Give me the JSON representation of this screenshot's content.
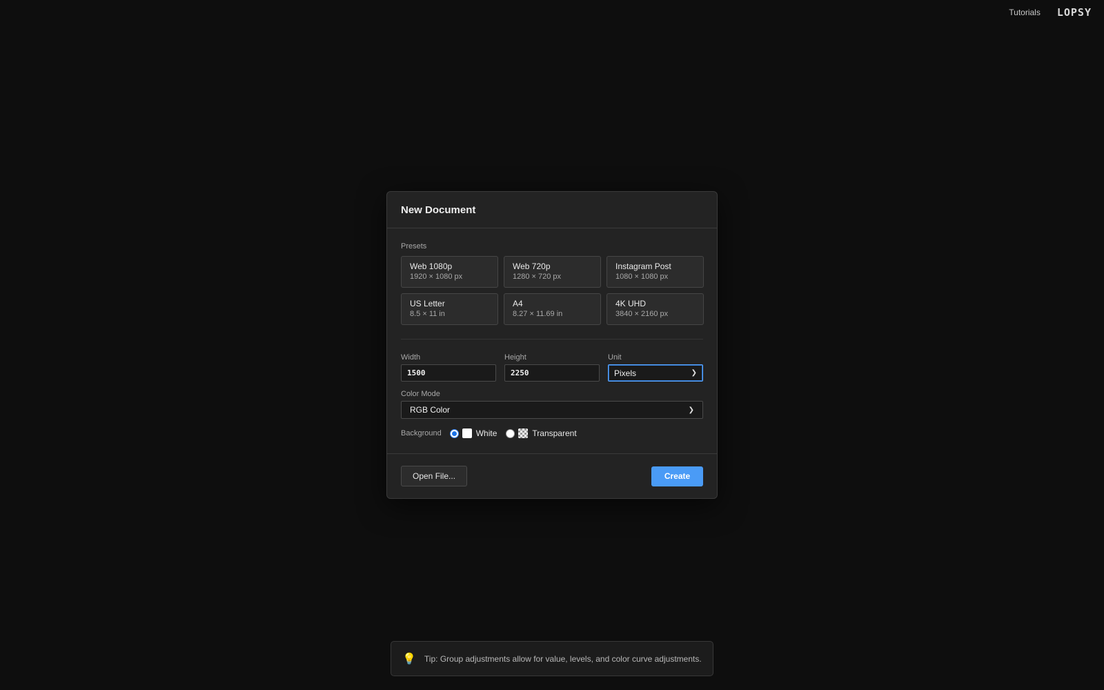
{
  "topbar": {
    "tutorials_label": "Tutorials",
    "logo_text": "LOPSY"
  },
  "dialog": {
    "title": "New Document",
    "presets_label": "Presets",
    "presets": [
      {
        "name": "Web 1080p",
        "size": "1920 × 1080 px"
      },
      {
        "name": "Web 720p",
        "size": "1280 × 720 px"
      },
      {
        "name": "Instagram Post",
        "size": "1080 × 1080 px"
      },
      {
        "name": "US Letter",
        "size": "8.5 × 11 in"
      },
      {
        "name": "A4",
        "size": "8.27 × 11.69 in"
      },
      {
        "name": "4K UHD",
        "size": "3840 × 2160 px"
      }
    ],
    "width": {
      "label": "Width",
      "value": "1500"
    },
    "height": {
      "label": "Height",
      "value": "2250"
    },
    "unit": {
      "label": "Unit",
      "selected": "Pixels"
    },
    "color_mode": {
      "label": "Color Mode",
      "selected": "RGB Color"
    },
    "background": {
      "label": "Background",
      "options": [
        {
          "label": "White",
          "checked": true
        },
        {
          "label": "Transparent",
          "checked": false
        }
      ]
    },
    "open_file_label": "Open File...",
    "create_label": "Create"
  },
  "tip": {
    "text": "Tip: Group adjustments allow for value, levels, and color curve adjustments."
  },
  "colors": {
    "accent": "#4a9bf6",
    "background": "#0e0e0e",
    "dialog": "#232323"
  }
}
